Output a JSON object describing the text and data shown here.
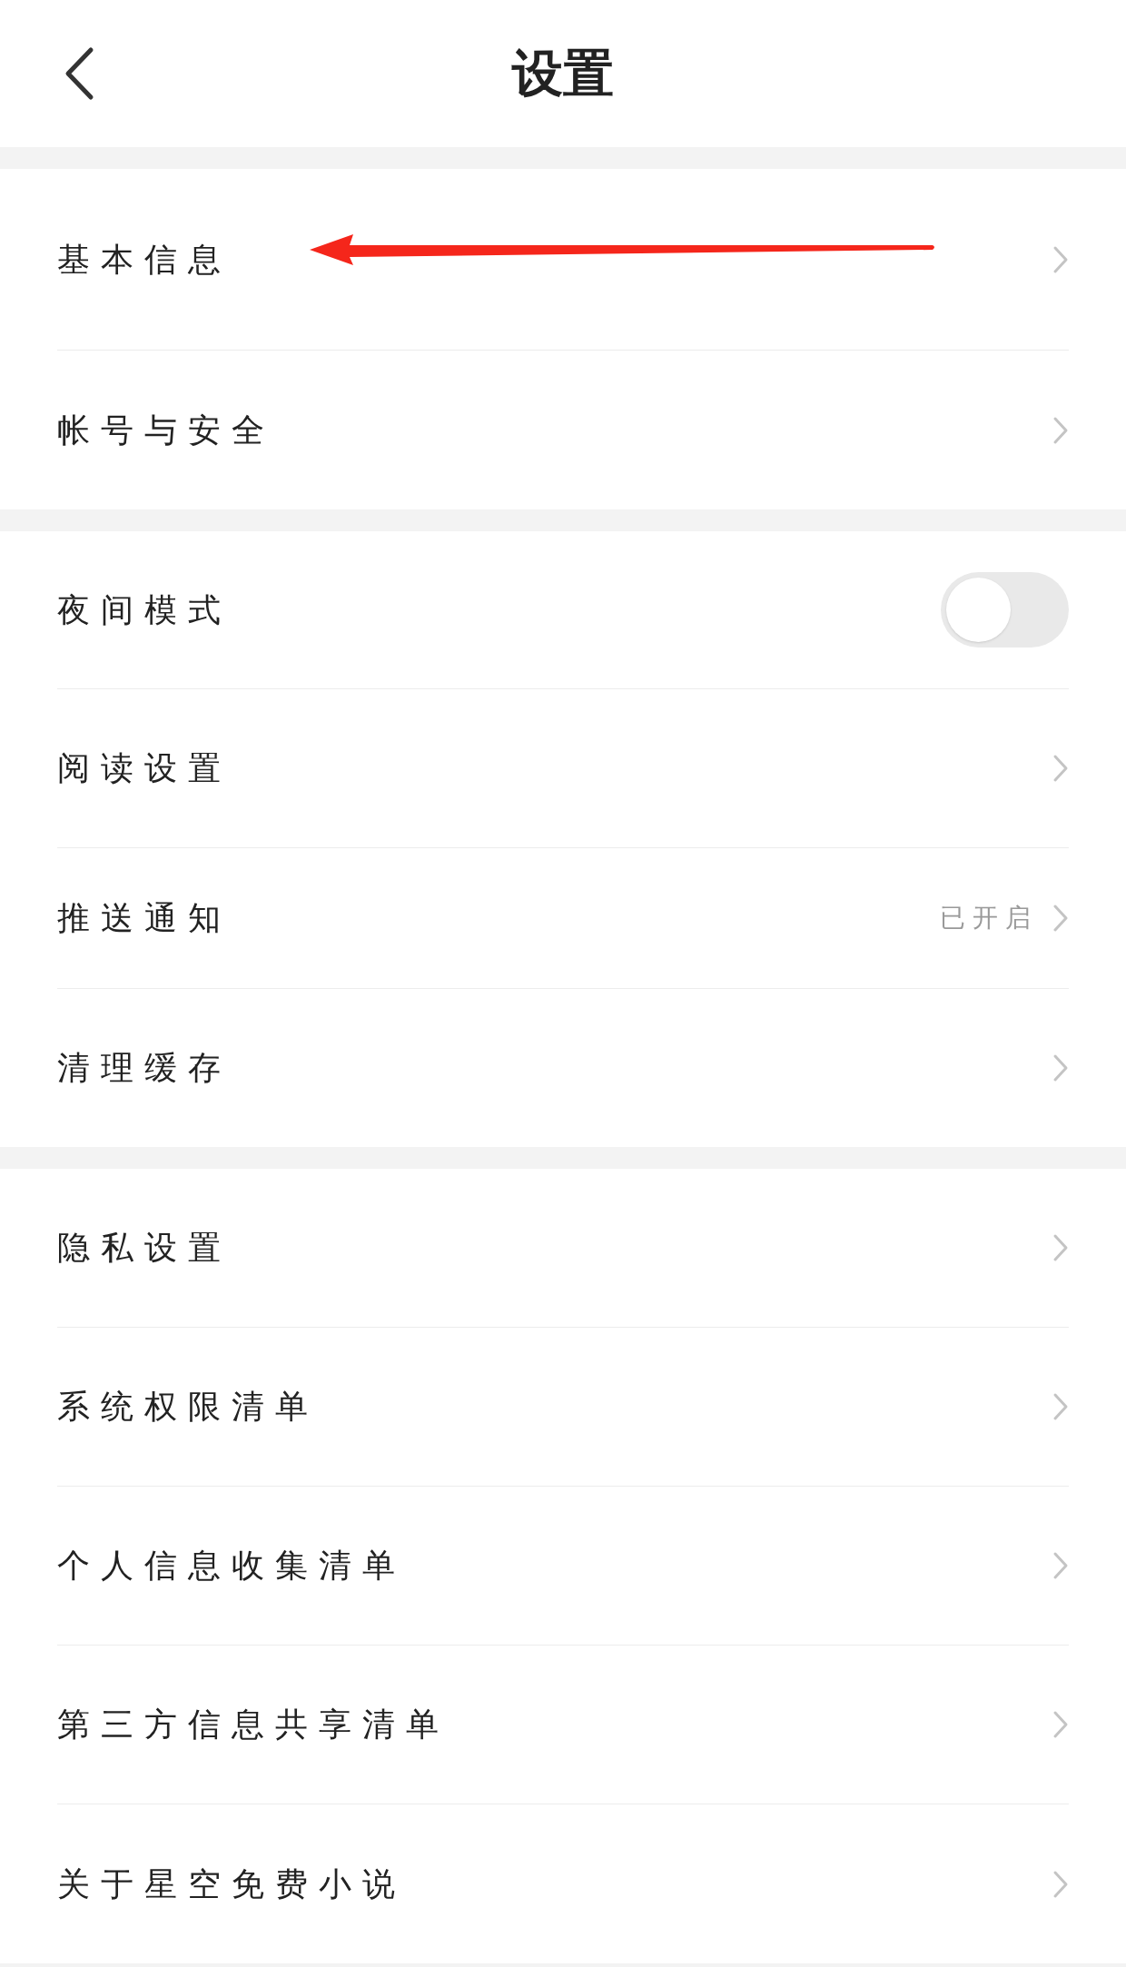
{
  "header": {
    "title": "设置"
  },
  "sections": [
    {
      "items": [
        {
          "kind": "link",
          "label": "基本信息",
          "annotated": true
        },
        {
          "kind": "link",
          "label": "帐号与安全"
        }
      ]
    },
    {
      "items": [
        {
          "kind": "toggle",
          "label": "夜间模式",
          "on": false
        },
        {
          "kind": "link",
          "label": "阅读设置"
        },
        {
          "kind": "link",
          "label": "推送通知",
          "value": "已开启"
        },
        {
          "kind": "link",
          "label": "清理缓存"
        }
      ]
    },
    {
      "items": [
        {
          "kind": "link",
          "label": "隐私设置"
        },
        {
          "kind": "link",
          "label": "系统权限清单"
        },
        {
          "kind": "link",
          "label": "个人信息收集清单"
        },
        {
          "kind": "link",
          "label": "第三方信息共享清单"
        },
        {
          "kind": "link",
          "label": "关于星空免费小说"
        }
      ]
    }
  ]
}
